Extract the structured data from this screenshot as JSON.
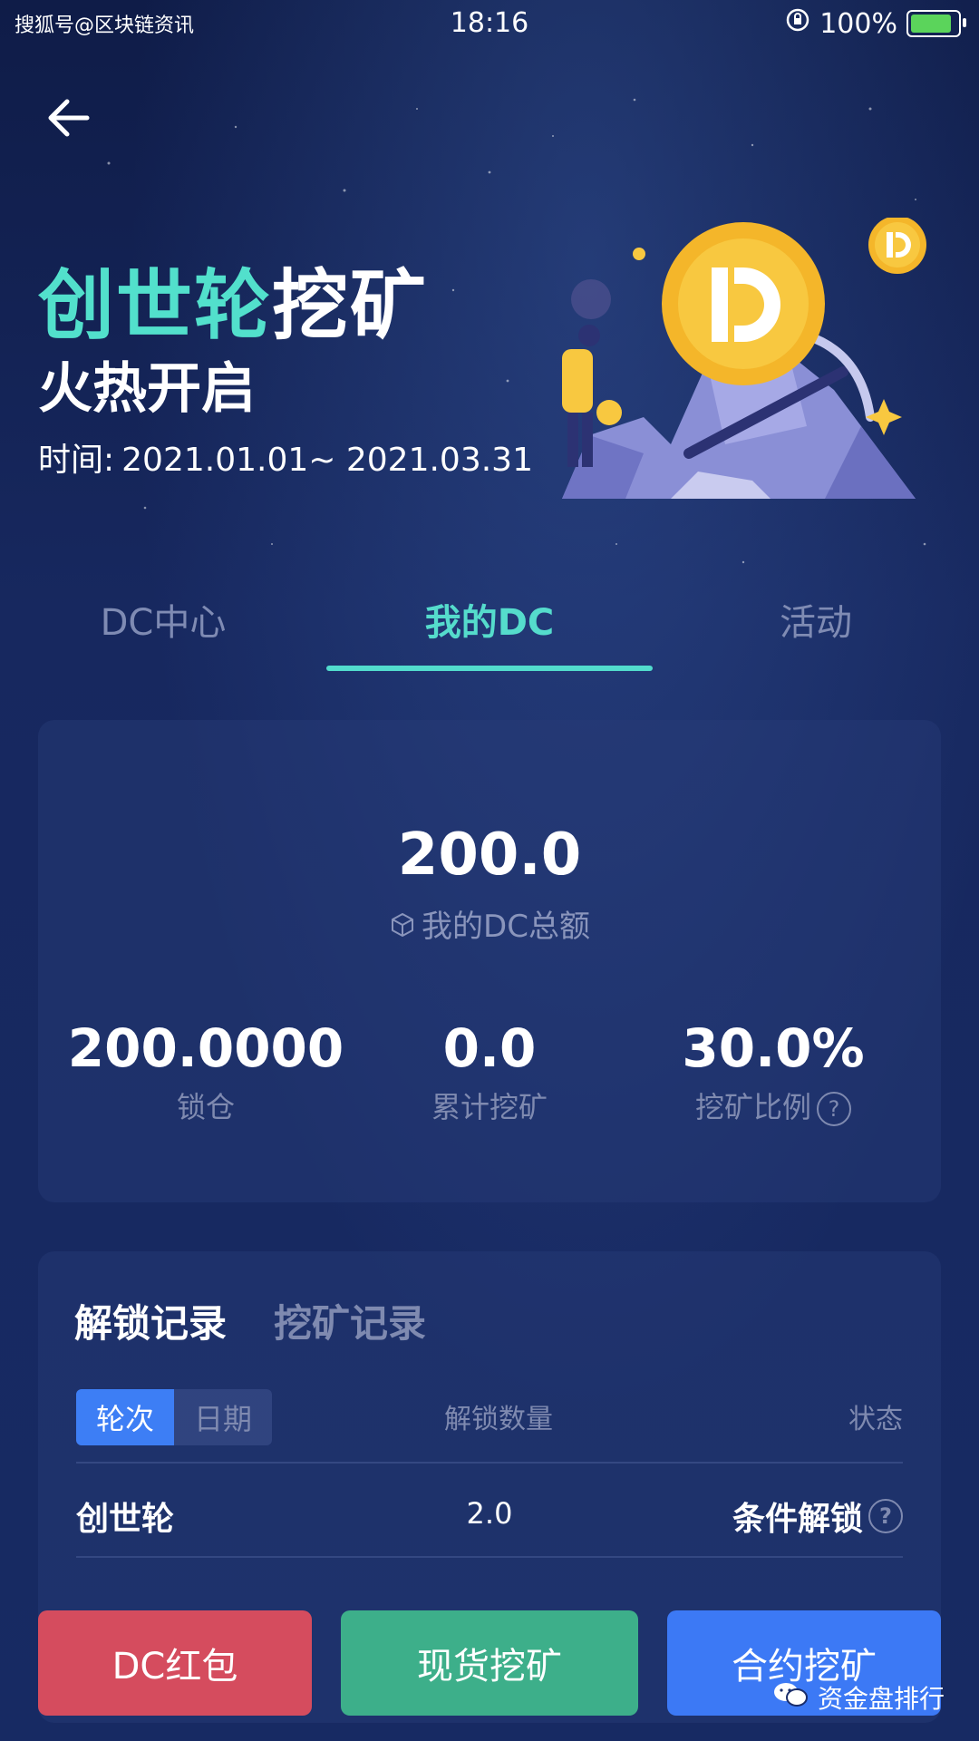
{
  "status_bar": {
    "carrier_watermark": "搜狐号@区块链资讯",
    "time": "18:16",
    "battery": "100%"
  },
  "hero": {
    "title_accent": "创世轮",
    "title_rest": "挖矿",
    "subtitle": "火热开启",
    "time_label": "时间:",
    "time_value": "2021.01.01~ 2021.03.31"
  },
  "tabs": [
    {
      "label": "DC中心",
      "active": false
    },
    {
      "label": "我的DC",
      "active": true
    },
    {
      "label": "活动",
      "active": false
    }
  ],
  "summary": {
    "total_value": "200.0",
    "total_label": "我的DC总额",
    "stats": [
      {
        "value": "200.0000",
        "label": "锁仓"
      },
      {
        "value": "0.0",
        "label": "累计挖矿"
      },
      {
        "value": "30.0%",
        "label": "挖矿比例"
      }
    ]
  },
  "records": {
    "tabs": [
      {
        "label": "解锁记录",
        "active": true
      },
      {
        "label": "挖矿记录",
        "active": false
      }
    ],
    "segment": [
      {
        "label": "轮次",
        "active": true
      },
      {
        "label": "日期",
        "active": false
      }
    ],
    "columns": {
      "amount": "解锁数量",
      "status": "状态"
    },
    "rows": [
      {
        "round": "创世轮",
        "amount": "2.0",
        "status": "条件解锁"
      }
    ]
  },
  "buttons": {
    "red": "DC红包",
    "green": "现货挖矿",
    "blue": "合约挖矿"
  },
  "watermark_bottom": "资金盘排行",
  "colors": {
    "accent": "#52e0cc",
    "red_button": "#d54c5e",
    "green_button": "#3daf8a",
    "blue_button": "#3c79f5"
  }
}
